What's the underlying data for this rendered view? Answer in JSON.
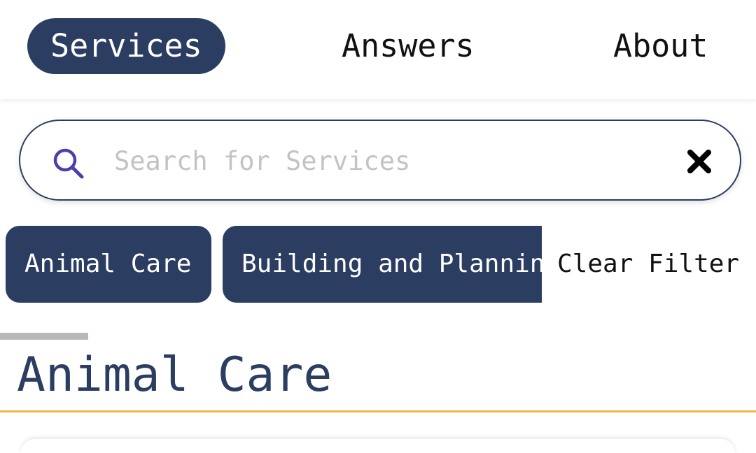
{
  "nav": {
    "items": [
      {
        "label": "Services",
        "active": true
      },
      {
        "label": "Answers",
        "active": false
      },
      {
        "label": "About",
        "active": false
      }
    ]
  },
  "search": {
    "placeholder": "Search for Services",
    "value": "",
    "icon": "search-icon",
    "clear_icon": "close-icon"
  },
  "filters": {
    "chips": [
      "Animal Care",
      "Building and Planning"
    ],
    "clear_label": "Clear Filter"
  },
  "section": {
    "title": "Animal Care"
  },
  "colors": {
    "primary": "#2b3d61",
    "accent": "#f0b54a",
    "search_icon": "#4a3fb0",
    "placeholder": "#c3c3c3"
  }
}
